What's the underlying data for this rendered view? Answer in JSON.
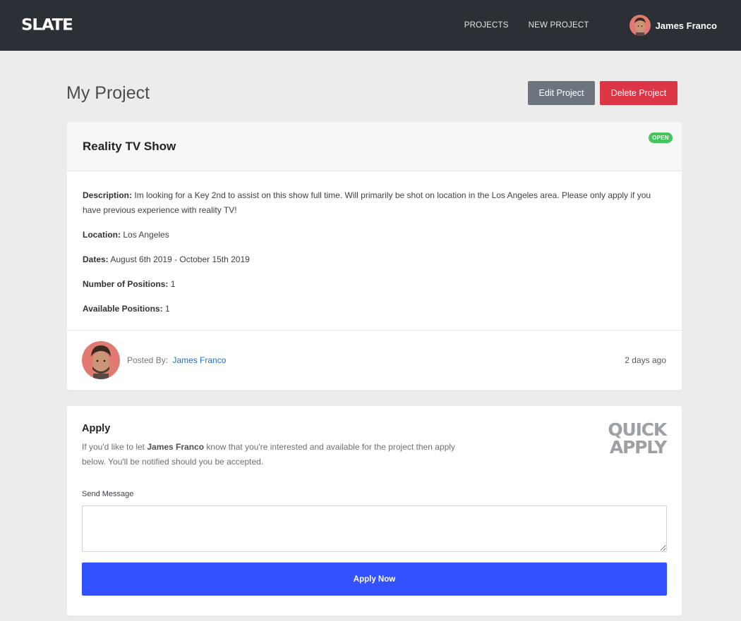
{
  "navbar": {
    "brand": "SLATE",
    "links": [
      "PROJECTS",
      "NEW PROJECT"
    ],
    "user_name": "James Franco"
  },
  "page": {
    "title": "My Project",
    "edit_label": "Edit Project",
    "delete_label": "Delete Project"
  },
  "project": {
    "title": "Reality TV Show",
    "status": "OPEN",
    "details": [
      {
        "label": "Description:",
        "value": "Im looking for a Key 2nd to assist on this show full time. Will primarily be shot on location in the Los Angeles area. Please only apply if you have previous experience with reality TV!"
      },
      {
        "label": "Location:",
        "value": "Los Angeles"
      },
      {
        "label": "Dates:",
        "value": "August 6th 2019 - October 15th 2019"
      },
      {
        "label": "Number of Positions:",
        "value": "1"
      },
      {
        "label": "Available Positions:",
        "value": "1"
      }
    ],
    "posted_by_label": "Posted By:",
    "posted_by_name": "James Franco",
    "posted_time": "2 days ago"
  },
  "apply": {
    "title": "Apply",
    "text_before": "If you'd like to let ",
    "text_name": "James Franco",
    "text_after": " know that you're interested and available for the project then apply below. You'll be notified should you be accepted.",
    "logo_line1": "QUICK",
    "logo_line2": "APPLY",
    "message_label": "Send Message",
    "message_value": "",
    "button_label": "Apply Now"
  },
  "colors": {
    "navbar": "#2b2f36",
    "edit_button": "#6c757d",
    "delete_button": "#dc3545",
    "status_open": "#45c35d",
    "link": "#1f6fdc",
    "apply_button": "#3352ff"
  },
  "icons": {
    "user_avatar": "avatar-icon",
    "poster_avatar": "avatar-icon"
  }
}
